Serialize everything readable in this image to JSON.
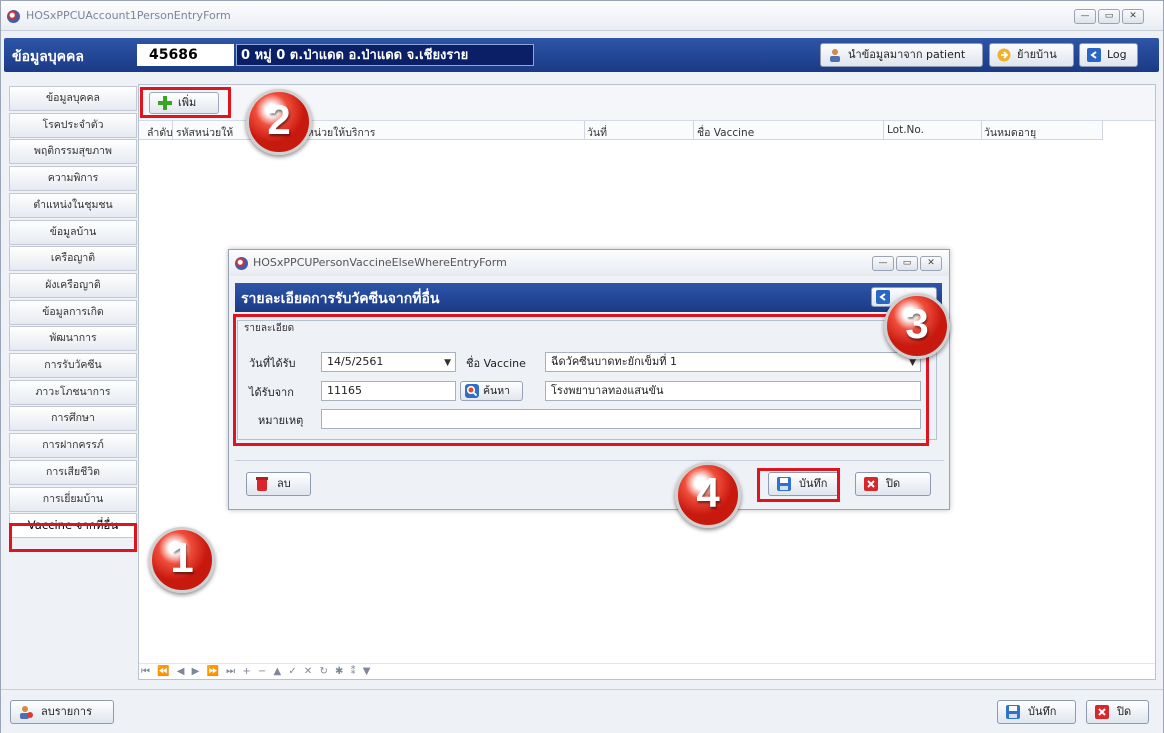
{
  "window": {
    "title": "HOSxPPCUAccount1PersonEntryForm"
  },
  "header": {
    "label": "ข้อมูลบุคคล",
    "person_id": "45686",
    "address": "0 หมู่ 0 ต.ป่าแดด อ.ป่าแดด จ.เชียงราย",
    "import_button": "นำข้อมูลมาจาก patient",
    "move_button": "ย้ายบ้าน",
    "log_button": "Log"
  },
  "sidebar": {
    "items": [
      "ข้อมูลบุคคล",
      "โรคประจำตัว",
      "พฤติกรรมสุขภาพ",
      "ความพิการ",
      "ตำแหน่งในชุมชน",
      "ข้อมูลบ้าน",
      "เครือญาติ",
      "ผังเครือญาติ",
      "ข้อมูลการเกิด",
      "พัฒนาการ",
      "การรับวัคซีน",
      "ภาวะโภชนาการ",
      "การศึกษา",
      "การฝากครรภ์",
      "การเสียชีวิต",
      "การเยี่ยมบ้าน",
      "Vaccine จากที่อื่น"
    ],
    "selected_index": 16
  },
  "toolbar": {
    "add_label": "เพิ่ม"
  },
  "grid": {
    "columns": [
      "ลำดับ",
      "รหัสหน่วยให้",
      "หน่วยให้บริการ",
      "วันที่",
      "ชื่อ Vaccine",
      "Lot.No.",
      "วันหมดอายุ"
    ],
    "navigator": "⏮ ⏪ ◀ ▶ ⏩ ⏭ + − ▲ ✓ ✕ ↻ ✱ ⁑ ▼"
  },
  "dialog": {
    "title": "HOSxPPCUPersonVaccineElseWhereEntryForm",
    "heading": "รายละเอียดการรับวัคซีนจากที่อื่น",
    "group_title": "รายละเอียด",
    "fields": {
      "date_label": "วันที่ได้รับ",
      "date_value": "14/5/2561",
      "vaccine_label": "ชื่อ Vaccine",
      "vaccine_value": "ฉีดวัคซีนบาดทะยักเข็มที่ 1",
      "source_label": "ได้รับจาก",
      "source_code": "11165",
      "search_label": "ค้นหา",
      "source_name": "โรงพยาบาลทองแสนขัน",
      "note_label": "หมายเหตุ",
      "note_value": ""
    },
    "delete_label": "ลบ",
    "save_label": "บันทึก",
    "close_label": "ปิด"
  },
  "footer": {
    "clear_label": "ลบรายการ",
    "save_label": "บันทึก",
    "close_label": "ปิด"
  },
  "annotations": {
    "steps": [
      "1",
      "2",
      "3",
      "4"
    ]
  },
  "colors": {
    "header_blue": "#1f428f",
    "highlight_red": "#e0141e",
    "badge_red": "#d32416"
  }
}
